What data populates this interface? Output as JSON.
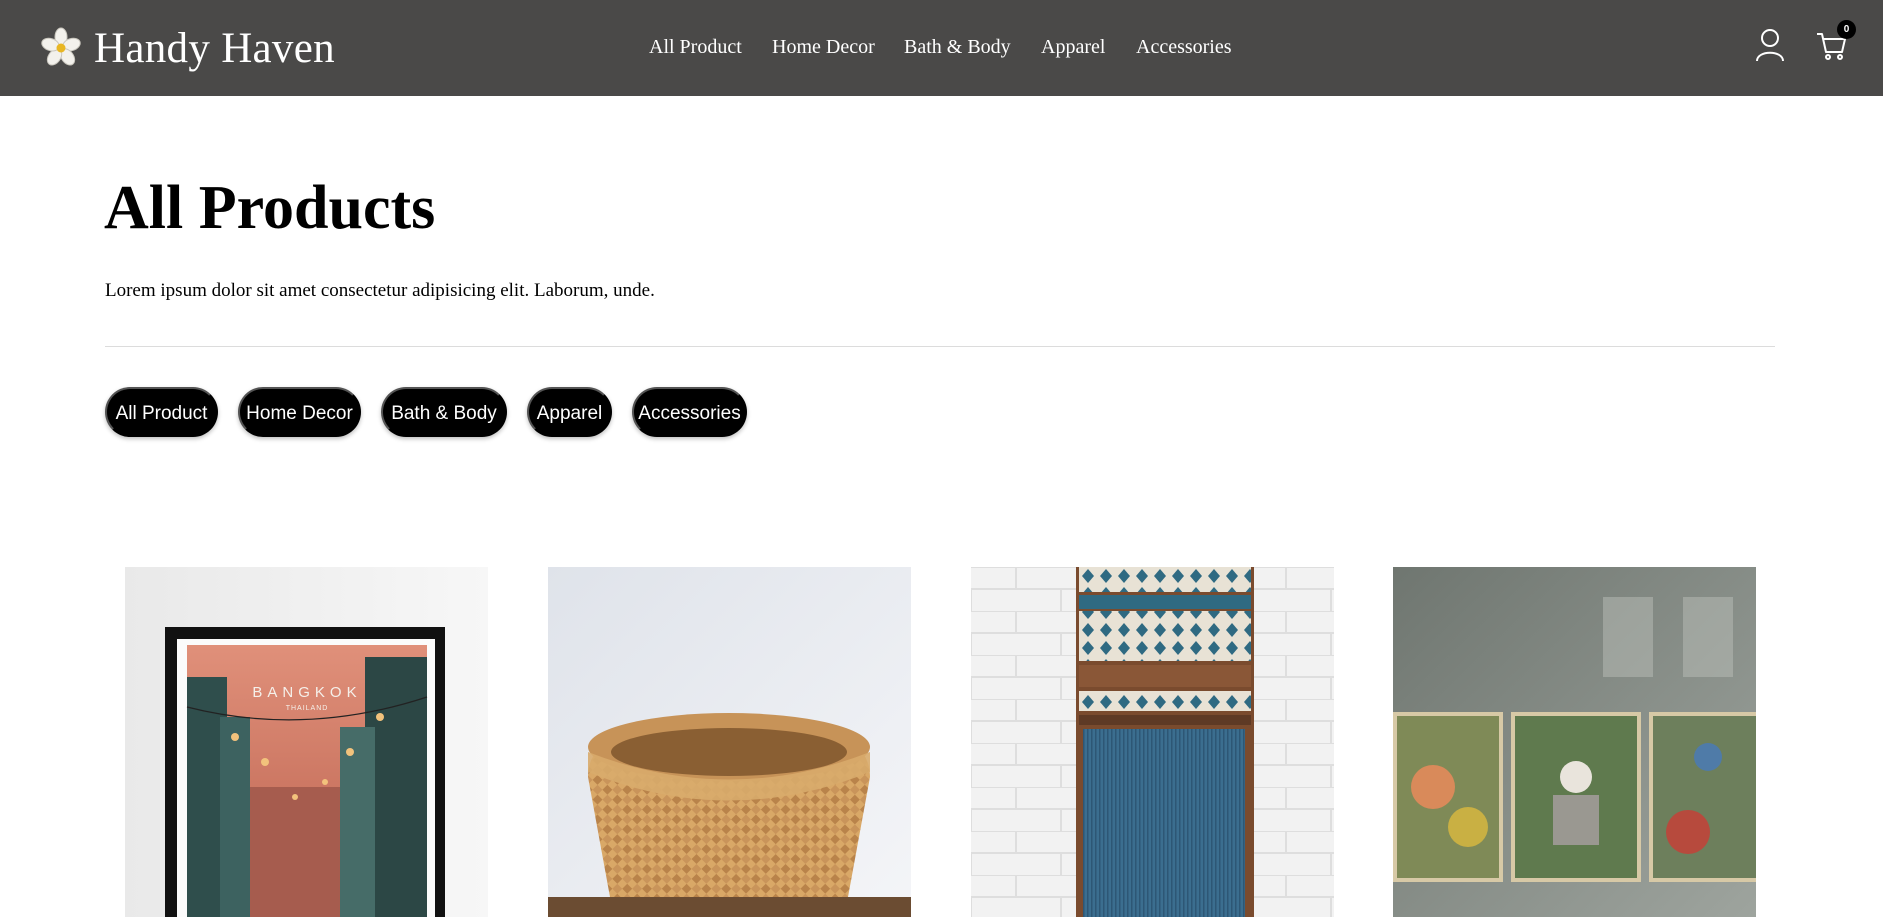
{
  "header": {
    "brand_name": "Handy Haven",
    "brand_icon": "flower-icon",
    "nav": [
      "All Product",
      "Home Decor",
      "Bath & Body",
      "Apparel",
      "Accessories"
    ],
    "user_icon": "user-icon",
    "cart_icon": "cart-icon",
    "cart_count": "0"
  },
  "main": {
    "title": "All Products",
    "description": "Lorem ipsum dolor sit amet consectetur adipisicing elit. Laborum, unde.",
    "filters": [
      "All Product",
      "Home Decor",
      "Bath & Body",
      "Apparel",
      "Accessories"
    ]
  },
  "products": [
    {
      "image": "bangkok-poster",
      "poster_title": "BANGKOK",
      "poster_subtitle": "THAILAND"
    },
    {
      "image": "woven-bamboo-basket"
    },
    {
      "image": "woven-textile-runner"
    },
    {
      "image": "floating-market-triptych"
    }
  ],
  "colors": {
    "header_bg": "#4a4948",
    "header_text": "#ffffff",
    "pill_bg": "#000000",
    "pill_text": "#ffffff"
  }
}
